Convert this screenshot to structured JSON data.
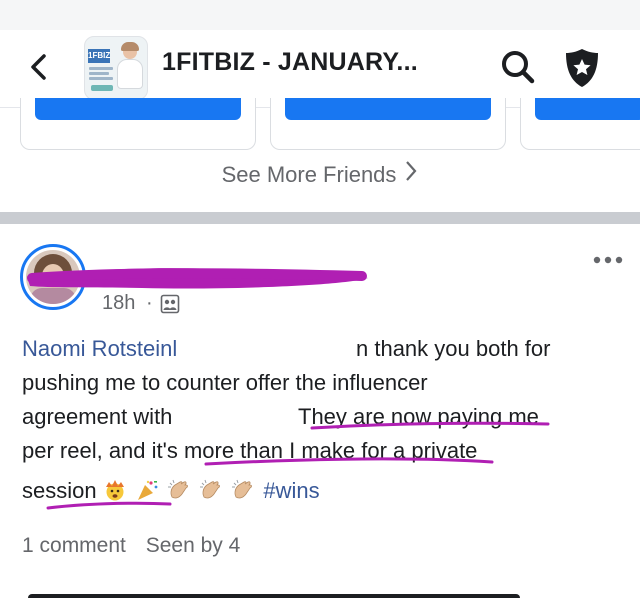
{
  "header": {
    "title": "1FITBIZ - JANUARY...",
    "thumb_logo": "1FBIZ"
  },
  "friends": {
    "see_more": "See More Friends"
  },
  "post": {
    "time": "18h",
    "separator": "·",
    "line1_mention": "Naomi Rotsteinl",
    "line1_rest": "n thank you both for",
    "line2": "pushing me to counter offer the influencer",
    "line3a": "agreement with",
    "line3b": "They are now paying me",
    "line4": "per reel, and it's more than I make for a private",
    "line5": "session",
    "hashtag": "#wins",
    "comments": "1 comment",
    "seen_by": "Seen by 4"
  },
  "colors": {
    "link": "#385898",
    "accent": "#1877f2",
    "scribble": "#b01fb3",
    "muted": "#65676b"
  },
  "icons": [
    "back-arrow-icon",
    "search-icon",
    "shield-star-icon",
    "more-dots-icon",
    "group-post-icon",
    "exploding-head-emoji",
    "party-popper-emoji",
    "clapping-hands-emoji"
  ]
}
